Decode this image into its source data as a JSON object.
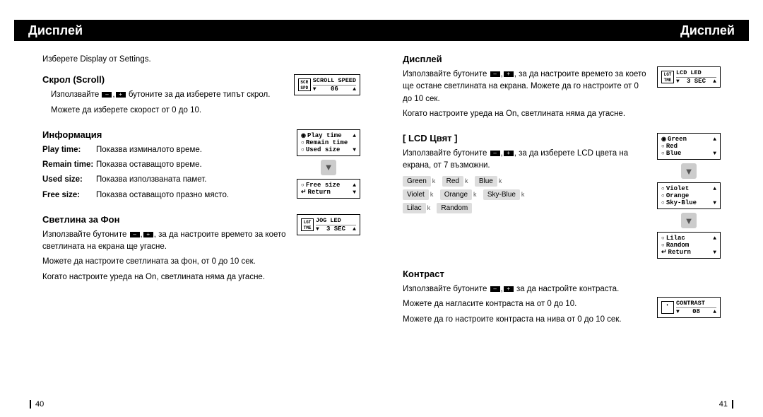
{
  "header": {
    "left": "Дисплей",
    "right": "Дисплей"
  },
  "left_page": {
    "intro": "Изберете Display от Settings.",
    "scroll": {
      "title": "Скрол (Scroll)",
      "line1": "Използвайте , бутоните за да изберете типът скрол.",
      "line2": "Можете да изберете скорост от 0 до 10.",
      "ui": {
        "label": "SCROLL SPEED",
        "value": "06"
      }
    },
    "info": {
      "title": "Информация",
      "rows": [
        {
          "label": "Play time:",
          "text": "Показва изминалото време."
        },
        {
          "label": "Remain time:",
          "text": "Показва оставащото време."
        },
        {
          "label": "Used size:",
          "text": "Показва използваната памет."
        },
        {
          "label": "Free size:",
          "text": "Показва оставащото празно място."
        }
      ],
      "ui1": {
        "l1": "Play time",
        "l2": "Remain time",
        "l3": "Used size"
      },
      "ui2": {
        "l1": "Free size",
        "l2": "Return"
      }
    },
    "backlight": {
      "title": "Светлина за Фон",
      "p1": "Използвайте бутоните  ,  , за да настроите времето за което светлината на екрана ще угасне.",
      "p2": "Можете да настроите светлината за фон, от 0 до 10 сек.",
      "p3": "Когато настроите уреда на On, светлината няма да угасне.",
      "ui": {
        "label": "JOG LED",
        "value": "3 SEC"
      }
    },
    "page_num": "40"
  },
  "right_page": {
    "display": {
      "title": "Дисплей",
      "p1": "Използвайте бутоните  ,  , за да настроите времето за което ще остане светлината на екрана. Можете да го настроите от 0 до 10 сек.",
      "p2": "Когато настроите уреда на On, светлината няма да угасне.",
      "ui": {
        "label": "LCD LED",
        "value": "3 SEC"
      }
    },
    "lcd_color": {
      "title": "[ LCD Цвят ]",
      "p1": "Използвайте бутоните  ,  , за да изберете LCD цвета на екрана, от 7 възможни.",
      "colors_row1": [
        "Green",
        "Red",
        "Blue"
      ],
      "colors_row2": [
        "Violet",
        "Orange",
        "Sky-Blue"
      ],
      "colors_row3": [
        "Lilac",
        "Random"
      ],
      "ui1": {
        "l1": "Green",
        "l2": "Red",
        "l3": "Blue"
      },
      "ui2": {
        "l1": "Violet",
        "l2": "Orange",
        "l3": "Sky-Blue"
      },
      "ui3": {
        "l1": "Lilac",
        "l2": "Random",
        "l3": "Return"
      }
    },
    "contrast": {
      "title": "Контраст",
      "p1": "Използвайте бутоните  ,  за да настройте контраста.",
      "p2": "Можете да нагласите контраста на от 0 до 10.",
      "p3": "Можете да го настроите контраста на нива от 0 до 10 сек.",
      "ui": {
        "label": "CONTRAST",
        "value": "08"
      }
    },
    "page_num": "41"
  }
}
